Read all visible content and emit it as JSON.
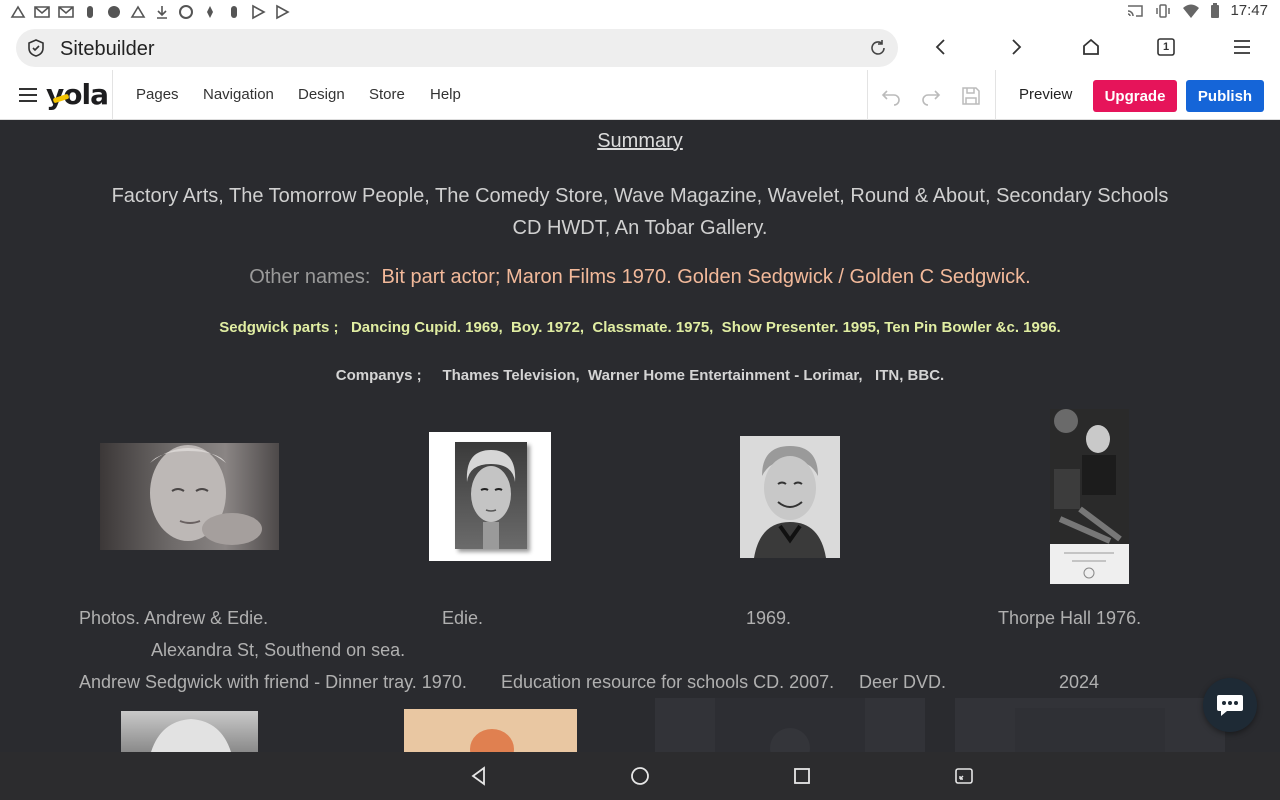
{
  "status_bar": {
    "time": "17:47"
  },
  "browser": {
    "url_title": "Sitebuilder",
    "tab_count": "1"
  },
  "editor": {
    "logo": "yola",
    "menu": {
      "pages": "Pages",
      "navigation": "Navigation",
      "design": "Design",
      "store": "Store",
      "help": "Help"
    },
    "preview": "Preview",
    "upgrade": "Upgrade",
    "publish": "Publish"
  },
  "content": {
    "summary": "Summary",
    "paragraph": "Factory Arts, The Tomorrow People, The Comedy Store, Wave Magazine, Wavelet, Round & About, Secondary Schools CD HWDT, An Tobar Gallery.",
    "other_names_label": "Other names:",
    "other_names_value": "Bit part actor;  Maron Films 1970.  Golden Sedgwick / Golden C Sedgwick.",
    "parts": "Sedgwick parts ;   Dancing Cupid. 1969,  Boy. 1972,  Classmate. 1975,  Show Presenter. 1995, Ten Pin Bowler &c. 1996.",
    "companies": "Companys ;     Thames Television,  Warner Home Entertainment - Lorimar,   ITN, BBC.",
    "captions": {
      "c1_line1": "Photos.  Andrew & Edie.",
      "c1_line2": "Alexandra St, Southend on sea.",
      "c2": "Edie.",
      "c3": "1969.",
      "c4": "Thorpe Hall  1976.",
      "row2_1": "Andrew Sedgwick with friend - Dinner tray. 1970.",
      "row2_2": "Education resource for schools CD. 2007.",
      "row2_3": "Deer DVD.",
      "row2_4": "2024"
    }
  },
  "colors": {
    "upgrade": "#e6145a",
    "publish": "#1565d8",
    "page_bg": "#2a2b2f",
    "highlight": "#f2b99a",
    "parts_text": "#e0eda2"
  }
}
